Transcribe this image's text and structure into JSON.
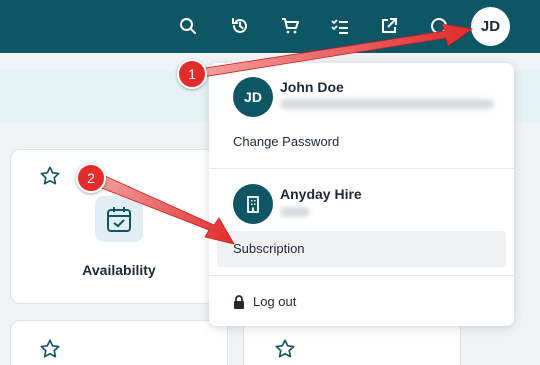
{
  "topbar": {
    "icons": [
      "search-icon",
      "history-icon",
      "cart-icon",
      "checklist-icon",
      "external-link-icon",
      "help-icon"
    ],
    "avatar_initials": "JD"
  },
  "cards": [
    {
      "title": "Availability",
      "icon": "calendar-check-icon"
    },
    {
      "title": "",
      "icon": "star-icon"
    },
    {
      "title": "",
      "icon": "star-icon"
    }
  ],
  "user_menu": {
    "user": {
      "initials": "JD",
      "name": "John Doe"
    },
    "change_password": "Change Password",
    "company": {
      "name": "Anyday Hire",
      "icon": "building-icon"
    },
    "subscription": "Subscription",
    "logout": "Log out"
  },
  "callouts": [
    "1",
    "2"
  ],
  "colors": {
    "topbar": "#0f5665",
    "avatar": "#0f5665",
    "callout": "#e22b2b"
  }
}
